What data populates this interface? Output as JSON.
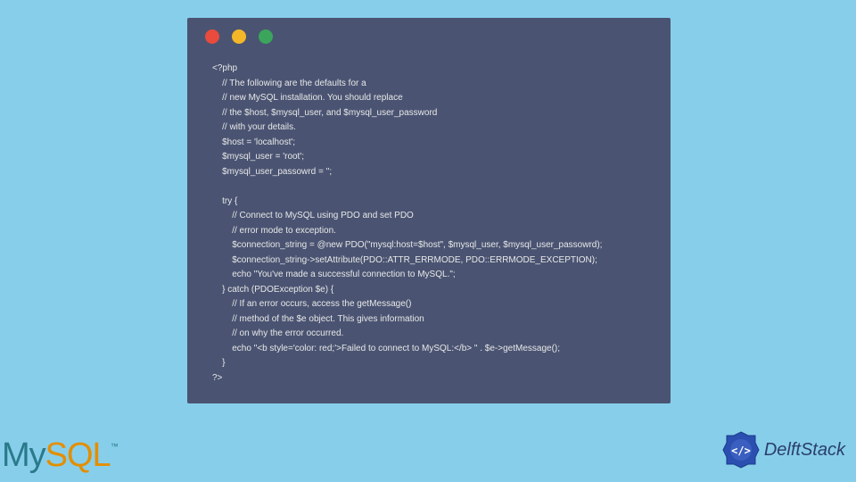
{
  "window": {
    "dots": [
      "red",
      "yellow",
      "green"
    ]
  },
  "code": {
    "content": "<?php\n    // The following are the defaults for a\n    // new MySQL installation. You should replace\n    // the $host, $mysql_user, and $mysql_user_password\n    // with your details.\n    $host = 'localhost';\n    $mysql_user = 'root';\n    $mysql_user_passowrd = '';\n\n    try {\n        // Connect to MySQL using PDO and set PDO\n        // error mode to exception.\n        $connection_string = @new PDO(\"mysql:host=$host\", $mysql_user, $mysql_user_passowrd);\n        $connection_string->setAttribute(PDO::ATTR_ERRMODE, PDO::ERRMODE_EXCEPTION);\n        echo \"You've made a successful connection to MySQL.\";\n    } catch (PDOException $e) {\n        // If an error occurs, access the getMessage()\n        // method of the $e object. This gives information\n        // on why the error occurred.\n        echo \"<b style='color: red;'>Failed to connect to MySQL:</b> \" . $e->getMessage();\n    }\n?>"
  },
  "logos": {
    "mysql_my": "My",
    "mysql_sql": "SQL",
    "mysql_tm": "™",
    "delft": "DelftStack"
  }
}
